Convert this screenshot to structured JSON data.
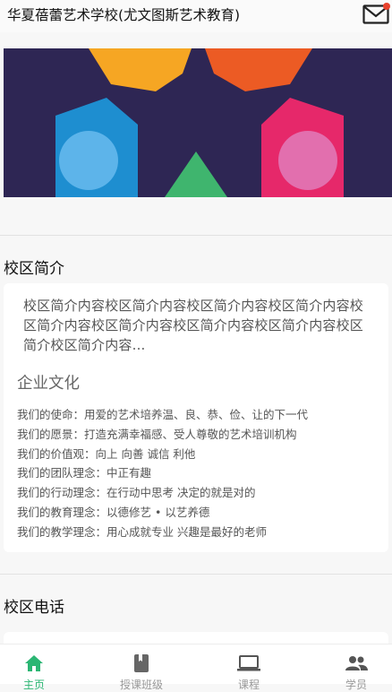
{
  "header": {
    "title": "华夏蓓蕾艺术学校(尤文图斯艺术教育)",
    "mail_icon": "mail-icon",
    "notification_color": "#e8412c"
  },
  "banner": {
    "image": "colorful-logo-banner"
  },
  "intro_section": {
    "title": "校区简介",
    "text": "校区简介内容校区简介内容校区简介内容校区简介内容校区简介内容校区简介内容校区简介内容校区简介内容校区简介校区简介内容..."
  },
  "culture": {
    "title": "企业文化",
    "items": [
      "我们的使命：用爱的艺术培养温、良、恭、俭、让的下一代",
      "我们的愿景：打造充满幸福感、受人尊敬的艺术培训机构",
      "我们的价值观：向上 向善 诚信 利他",
      "我们的团队理念：中正有趣",
      "我们的行动理念：在行动中思考  决定的就是对的",
      "我们的教育理念：以德修艺 • 以艺养德",
      "我们的教学理念：用心成就专业  兴趣是最好的老师"
    ]
  },
  "phone_section": {
    "title": "校区电话"
  },
  "tabbar": {
    "active_color": "#2bb673",
    "tabs": [
      {
        "label": "主页",
        "icon": "home-icon"
      },
      {
        "label": "授课班级",
        "icon": "book-icon"
      },
      {
        "label": "课程",
        "icon": "laptop-icon"
      },
      {
        "label": "学员",
        "icon": "people-icon"
      }
    ]
  }
}
